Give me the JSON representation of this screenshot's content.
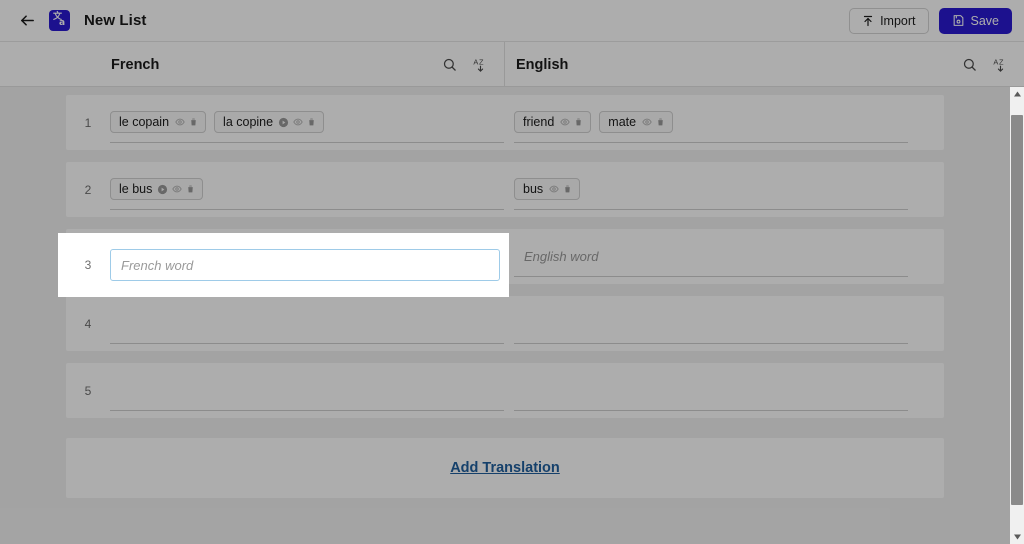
{
  "app": {
    "title": "New List",
    "back_icon": "arrow-left-icon",
    "logo_icon": "translate-app-icon",
    "logo_glyph_primary": "文",
    "logo_glyph_secondary": "a"
  },
  "toolbar": {
    "import_label": "Import",
    "import_icon": "upload-icon",
    "save_label": "Save",
    "save_icon": "save-disk-icon",
    "save_color": "#2a1ad1"
  },
  "columns": {
    "source": {
      "language": "French",
      "search_icon": "search-icon",
      "sort_icon": "sort-alpha-icon"
    },
    "target": {
      "language": "English",
      "search_icon": "search-icon",
      "sort_icon": "sort-alpha-icon"
    }
  },
  "rows": [
    {
      "number": "1",
      "source_chips": [
        {
          "label": "le copain",
          "icons": [
            "eye-off-icon",
            "trash-icon"
          ]
        },
        {
          "label": "la copine",
          "icons": [
            "play-circle-icon",
            "eye-off-icon",
            "trash-icon"
          ]
        }
      ],
      "target_chips": [
        {
          "label": "friend",
          "icons": [
            "eye-off-icon",
            "trash-icon"
          ]
        },
        {
          "label": "mate",
          "icons": [
            "eye-off-icon",
            "trash-icon"
          ]
        }
      ]
    },
    {
      "number": "2",
      "source_chips": [
        {
          "label": "le bus",
          "icons": [
            "play-circle-icon",
            "eye-off-icon",
            "trash-icon"
          ]
        }
      ],
      "target_chips": [
        {
          "label": "bus",
          "icons": [
            "eye-off-icon",
            "trash-icon"
          ]
        }
      ]
    },
    {
      "number": "3",
      "source_placeholder": "French word",
      "source_value": "",
      "target_placeholder": "English word",
      "target_value": "",
      "focused": true
    },
    {
      "number": "4",
      "source_chips": [],
      "target_chips": []
    },
    {
      "number": "5",
      "source_chips": [],
      "target_chips": []
    }
  ],
  "add_translation": {
    "label": "Add Translation",
    "color": "#1f5f9e"
  },
  "scrollbar": {
    "up_icon": "caret-up-icon",
    "down_icon": "caret-down-icon"
  },
  "spotlight": {
    "row_number": "3",
    "placeholder": "French word",
    "value": ""
  }
}
